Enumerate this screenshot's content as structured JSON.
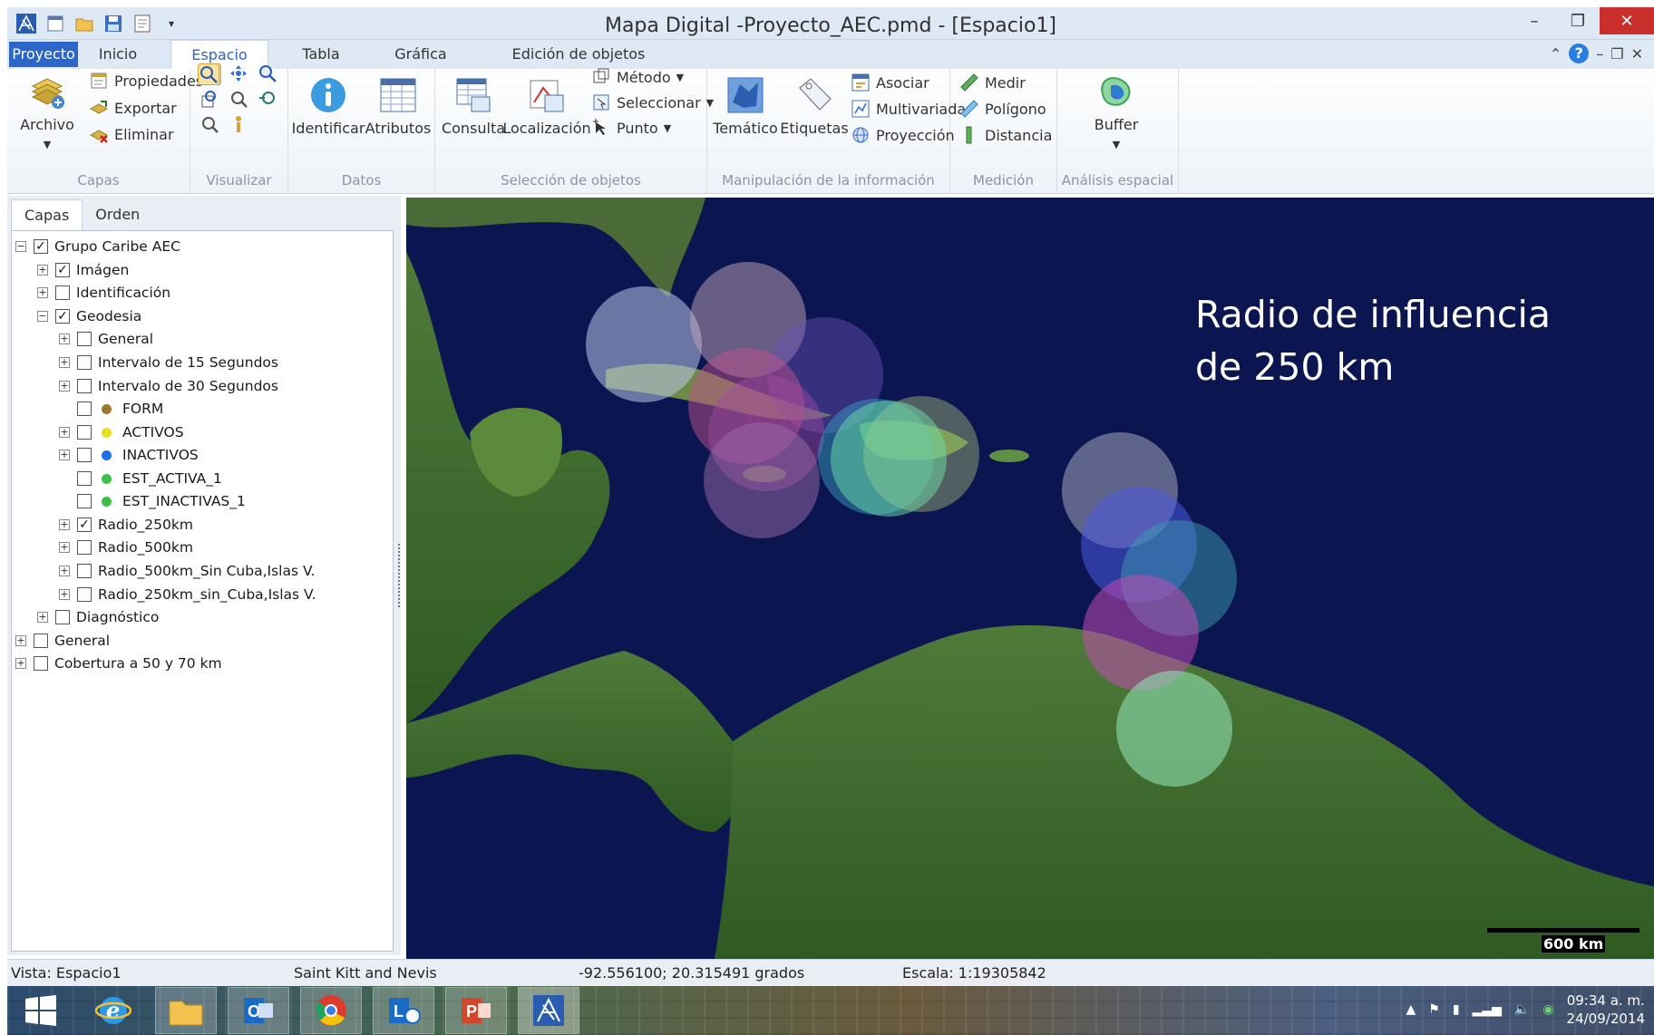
{
  "window": {
    "title": "Mapa Digital -Proyecto_AEC.pmd - [Espacio1]"
  },
  "ribbon_tabs": [
    "Proyecto",
    "Inicio",
    "Espacio",
    "Tabla",
    "Gráfica",
    "Edición de objetos"
  ],
  "active_tab": "Espacio",
  "ribbon": {
    "capas": {
      "label": "Capas",
      "archivo": "Archivo",
      "propiedades": "Propiedades",
      "exportar": "Exportar",
      "eliminar": "Eliminar"
    },
    "visualizar": {
      "label": "Visualizar"
    },
    "datos": {
      "label": "Datos",
      "identificar": "Identificar",
      "atributos": "Atributos"
    },
    "seleccion": {
      "label": "Selección de objetos",
      "consulta": "Consulta",
      "localizacion": "Localización",
      "metodo": "Método",
      "seleccionar": "Seleccionar",
      "punto": "Punto"
    },
    "manipulacion": {
      "label": "Manipulación de la información",
      "tematico": "Temático",
      "etiquetas": "Etiquetas",
      "asociar": "Asociar",
      "multivariada": "Multivariada",
      "proyeccion": "Proyección"
    },
    "medicion": {
      "label": "Medición",
      "medir": "Medir",
      "poligono": "Polígono",
      "distancia": "Distancia"
    },
    "analisis": {
      "label": "Análisis espacial",
      "buffer": "Buffer"
    }
  },
  "left_panel": {
    "tabs": [
      "Capas",
      "Orden"
    ],
    "tree": [
      {
        "label": "Grupo Caribe AEC",
        "checked": true
      },
      {
        "label": "Imágen",
        "checked": true
      },
      {
        "label": "Identificación",
        "checked": false
      },
      {
        "label": "Geodesia",
        "checked": true
      },
      {
        "label": "General",
        "checked": false
      },
      {
        "label": "Intervalo de 15 Segundos",
        "checked": false
      },
      {
        "label": "Intervalo de 30 Segundos",
        "checked": false
      },
      {
        "label": "FORM",
        "checked": false
      },
      {
        "label": "ACTIVOS",
        "checked": false
      },
      {
        "label": "INACTIVOS",
        "checked": false
      },
      {
        "label": "EST_ACTIVA_1",
        "checked": false
      },
      {
        "label": "EST_INACTIVAS_1",
        "checked": false
      },
      {
        "label": "Radio_250km",
        "checked": true
      },
      {
        "label": "Radio_500km",
        "checked": false
      },
      {
        "label": "Radio_500km_Sin Cuba,Islas V.",
        "checked": false
      },
      {
        "label": "Radio_250km_sin_Cuba,Islas V.",
        "checked": false
      },
      {
        "label": "Diagnóstico",
        "checked": false
      },
      {
        "label": "General",
        "checked": false
      },
      {
        "label": "Cobertura a 50 y 70 km",
        "checked": false
      }
    ],
    "colors": {
      "form": "#9a7a2a",
      "activos": "#e6e020",
      "inactivos": "#1f6fe0",
      "est_activa": "#3cc04a",
      "est_inactivas": "#3cc04a"
    }
  },
  "map": {
    "caption_line1": "Radio de influencia",
    "caption_line2": "de 250 km",
    "scale_label": "600 km",
    "ocean_color": "#0b1650"
  },
  "status": {
    "vista": "Vista: Espacio1",
    "place": "Saint Kitt and Nevis",
    "coords": "-92.556100; 20.315491 grados",
    "escala": "Escala: 1:19305842"
  },
  "taskbar": {
    "time": "09:34 a. m.",
    "date": "24/09/2014"
  }
}
